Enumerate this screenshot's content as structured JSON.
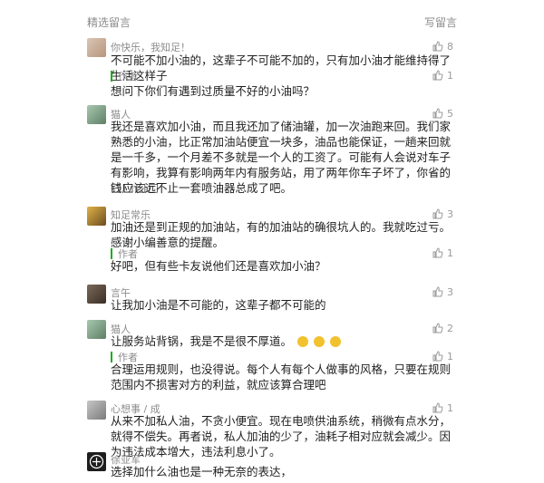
{
  "header": {
    "title": "精选留言",
    "write": "写留言"
  },
  "comments": [
    {
      "name": "你快乐，我知足！",
      "text": "不可能不加小油的，这辈子不可能不加的，只有加小油才能维持得了生活这样子",
      "likes": "8",
      "reply_likes": "1",
      "reply_text": "想问下你们有遇到过质量不好的小油吗？"
    },
    {
      "name": "猫人",
      "text": "我还是喜欢加小油，而且我还加了储油罐，加一次油跑来回。我们家熟悉的小油，比正常加油站便宜一块多，油品也能保证，一趟来回就是一千多，一个月差不多就是一个人的工资了。可能有人会说对车子有影响，我算有影响两年内有服务站，用了两年你车子坏了，你省的钱应该远不止一套喷油器总成了吧。",
      "likes": "5",
      "extra": "□□□□"
    },
    {
      "name": "知足常乐",
      "text": "加油还是到正规的加油站，有的加油站的确很坑人的。我就吃过亏。感谢小编善意的提醒。",
      "likes": "3",
      "reply_likes": "1",
      "reply_text": "好吧，但有些卡友说他们还是喜欢加小油？"
    },
    {
      "name": "言午",
      "text": "让我加小油是不可能的，这辈子都不可能的",
      "likes": "3"
    },
    {
      "name": "猫人",
      "text": "让服务站背锅，我是不是很不厚道。",
      "likes": "2",
      "author_label": "作者",
      "reply_likes": "1",
      "reply_text": "合理运用规则，也没得说。每个人有每个人做事的风格，只要在规则范围内不损害对方的利益，就应该算合理吧"
    },
    {
      "name": "心想事 / 成",
      "text": "从来不加私人油，不贪小便宜。现在电喷供油系统，稍微有点水分，就得不偿失。再者说，私人加油的少了，油耗子相对应就会减少。因为违法成本增大，违法利息小了。",
      "likes": "1"
    },
    {
      "name": "徐亚军",
      "text": "选择加什么油也是一种无奈的表达，",
      "likes": ""
    }
  ],
  "labels": {
    "author": "作者"
  },
  "icons": [
    "thumb-up-icon",
    "laugh-emoji-icon"
  ]
}
